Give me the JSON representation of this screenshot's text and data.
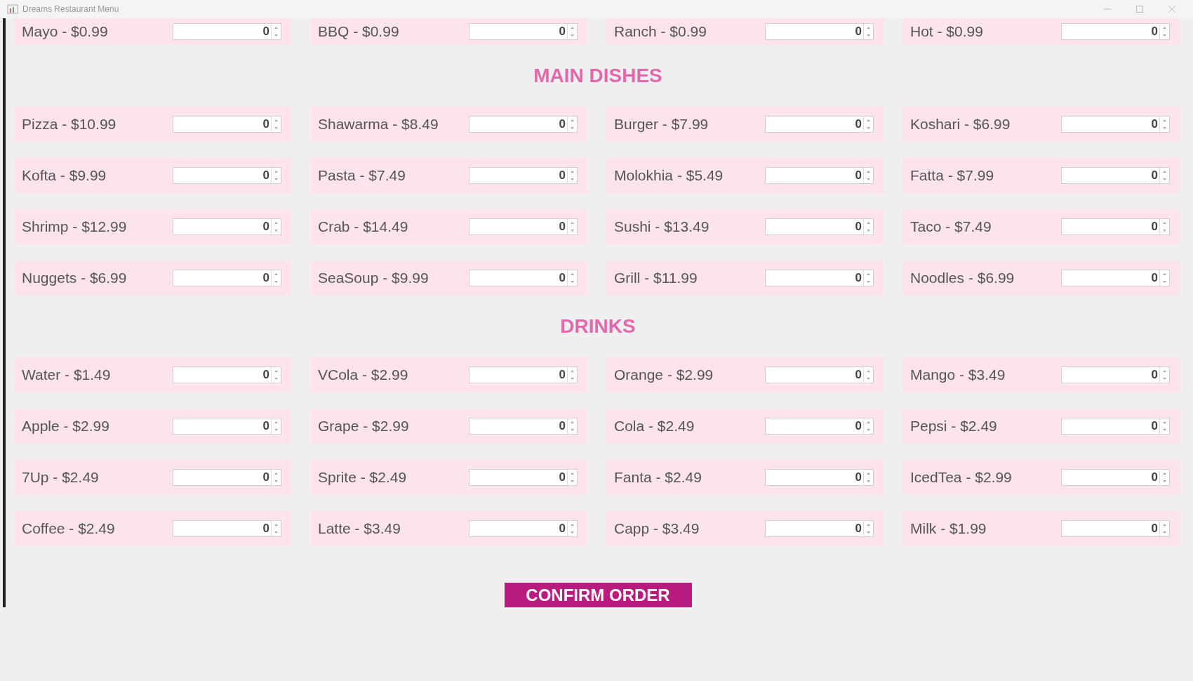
{
  "window": {
    "title": "Dreams Restaurant Menu"
  },
  "sections": [
    {
      "items": [
        {
          "label": "Mayo - $0.99",
          "value": "0"
        },
        {
          "label": "BBQ - $0.99",
          "value": "0"
        },
        {
          "label": "Ranch - $0.99",
          "value": "0"
        },
        {
          "label": "Hot - $0.99",
          "value": "0"
        }
      ]
    },
    {
      "heading": "MAIN DISHES",
      "items": [
        {
          "label": "Pizza - $10.99",
          "value": "0"
        },
        {
          "label": "Shawarma - $8.49",
          "value": "0"
        },
        {
          "label": "Burger - $7.99",
          "value": "0"
        },
        {
          "label": "Koshari - $6.99",
          "value": "0"
        },
        {
          "label": "Kofta - $9.99",
          "value": "0"
        },
        {
          "label": "Pasta - $7.49",
          "value": "0"
        },
        {
          "label": "Molokhia - $5.49",
          "value": "0"
        },
        {
          "label": "Fatta - $7.99",
          "value": "0"
        },
        {
          "label": "Shrimp - $12.99",
          "value": "0"
        },
        {
          "label": "Crab - $14.49",
          "value": "0"
        },
        {
          "label": "Sushi - $13.49",
          "value": "0"
        },
        {
          "label": "Taco - $7.49",
          "value": "0"
        },
        {
          "label": "Nuggets - $6.99",
          "value": "0"
        },
        {
          "label": "SeaSoup - $9.99",
          "value": "0"
        },
        {
          "label": "Grill - $11.99",
          "value": "0"
        },
        {
          "label": "Noodles - $6.99",
          "value": "0"
        }
      ]
    },
    {
      "heading": "DRINKS",
      "items": [
        {
          "label": "Water - $1.49",
          "value": "0"
        },
        {
          "label": "VCola - $2.99",
          "value": "0"
        },
        {
          "label": "Orange - $2.99",
          "value": "0"
        },
        {
          "label": "Mango - $3.49",
          "value": "0"
        },
        {
          "label": "Apple - $2.99",
          "value": "0"
        },
        {
          "label": "Grape - $2.99",
          "value": "0"
        },
        {
          "label": "Cola - $2.49",
          "value": "0"
        },
        {
          "label": "Pepsi - $2.49",
          "value": "0"
        },
        {
          "label": "7Up - $2.49",
          "value": "0"
        },
        {
          "label": "Sprite - $2.49",
          "value": "0"
        },
        {
          "label": "Fanta - $2.49",
          "value": "0"
        },
        {
          "label": "IcedTea - $2.99",
          "value": "0"
        },
        {
          "label": "Coffee - $2.49",
          "value": "0"
        },
        {
          "label": "Latte - $3.49",
          "value": "0"
        },
        {
          "label": "Capp - $3.49",
          "value": "0"
        },
        {
          "label": "Milk - $1.99",
          "value": "0"
        }
      ]
    }
  ],
  "confirm_button": "CONFIRM ORDER"
}
